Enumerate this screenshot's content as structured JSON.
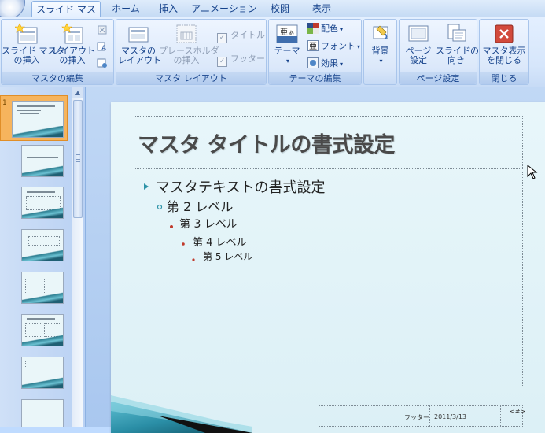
{
  "tabs": [
    {
      "label": "スライド マスタ",
      "active": true
    },
    {
      "label": "ホーム"
    },
    {
      "label": "挿入"
    },
    {
      "label": "アニメーション"
    },
    {
      "label": "校閲"
    },
    {
      "label": "表示"
    }
  ],
  "ribbon": {
    "groups": {
      "master_edit": {
        "label": "マスタの編集",
        "insert_master": "スライド マスタ\nの挿入",
        "insert_layout": "レイアウト\nの挿入"
      },
      "master_layout": {
        "label": "マスタ レイアウト",
        "master_layout_btn": "マスタの\nレイアウト",
        "insert_placeholder": "プレースホルダ\nの挿入",
        "title_check": "タイトル",
        "footer_check": "フッター"
      },
      "theme_edit": {
        "label": "テーマの編集",
        "theme": "テーマ",
        "colors": "配色",
        "fonts": "フォント",
        "effects": "効果"
      },
      "background": {
        "label": "",
        "background_btn": "背景"
      },
      "page_setup": {
        "label": "ページ設定",
        "page_setup_btn": "ページ\n設定",
        "slide_orientation": "スライドの\n向き"
      },
      "close": {
        "label": "閉じる",
        "close_master": "マスタ表示\nを閉じる"
      }
    }
  },
  "slide": {
    "title": "マスタ タイトルの書式設定",
    "levels": [
      "マスタテキストの書式設定",
      "第 2 レベル",
      "第 3 レベル",
      "第 4 レベル",
      "第 5 レベル"
    ],
    "footer_label": "フッター",
    "date": "2011/3/13",
    "page_number": "<#>"
  },
  "colors": {
    "accent_bullet": "#2e93a8",
    "red_bullet": "#c0392b",
    "active_thumb_border": "#e08e28"
  }
}
